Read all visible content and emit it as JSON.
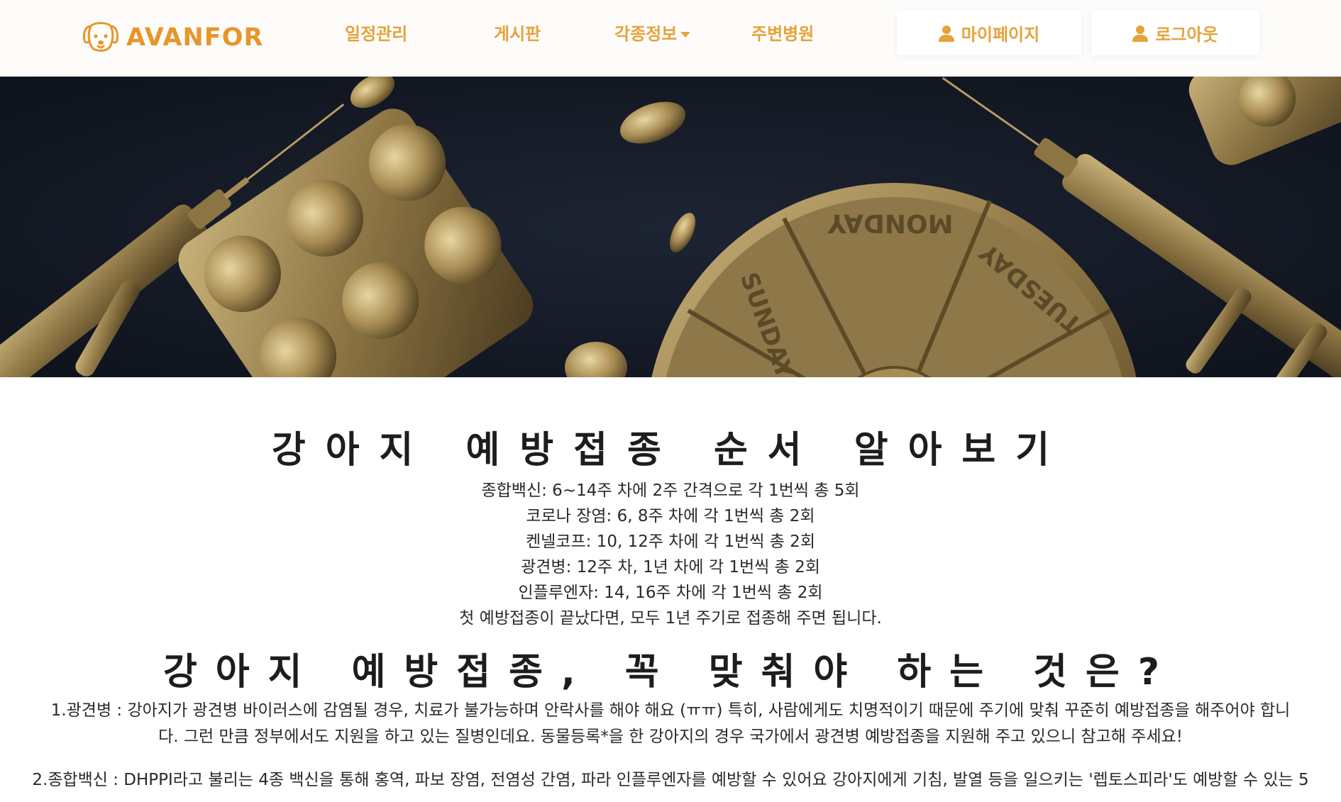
{
  "brand": {
    "name": "AVANFOR",
    "icon": "dog-face-icon",
    "color": "#e8962a"
  },
  "nav": {
    "items": [
      {
        "label": "일정관리"
      },
      {
        "label": "게시판"
      },
      {
        "label": "각종정보"
      },
      {
        "label": "주변병원"
      }
    ],
    "mypage_label": "마이페이지",
    "logout_label": "로그아웃",
    "accent_color": "#e6a23a"
  },
  "hero": {
    "icon": "medicine-pills-syringe-image",
    "pillbox_labels": [
      "MONDAY",
      "TUESDAY",
      "SUNDAY"
    ]
  },
  "content": {
    "title1": "강아지 예방접종 순서 알아보기",
    "schedule": [
      "종합백신: 6~14주 차에 2주 간격으로 각 1번씩 총 5회",
      "코로나 장염: 6, 8주 차에 각 1번씩 총 2회",
      "켄넬코프: 10, 12주 차에 각 1번씩 총 2회",
      "광견병: 12주 차, 1년 차에 각 1번씩 총 2회",
      "인플루엔자: 14, 16주 차에 각 1번씩 총 2회",
      "첫 예방접종이 끝났다면, 모두 1년 주기로 접종해 주면 됩니다."
    ],
    "title2": "강아지 예방접종, 꼭 맞춰야 하는 것은?",
    "para1_line1": "1.광견병 : 강아지가 광견병 바이러스에 감염될 경우, 치료가 불가능하며 안락사를 해야 해요 (ㅠㅠ) 특히, 사람에게도 치명적이기 때문에 주기에 맞춰 꾸준히 예방접종을 해주어야 합니",
    "para1_line2": "다. 그런 만큼 정부에서도 지원을 하고 있는 질병인데요. 동물등록*을 한 강아지의 경우 국가에서 광견병 예방접종을 지원해 주고 있으니 참고해 주세요!",
    "para2_line1": "2.종합백신 : DHPPI라고 불리는 4종 백신을 통해 홍역, 파보 장염, 전염성 간염, 파라 인플루엔자를 예방할 수 있어요 강아지에게 기침, 발열 등을 일으키는 '렙토스피라'도 예방할 수 있는 5"
  }
}
